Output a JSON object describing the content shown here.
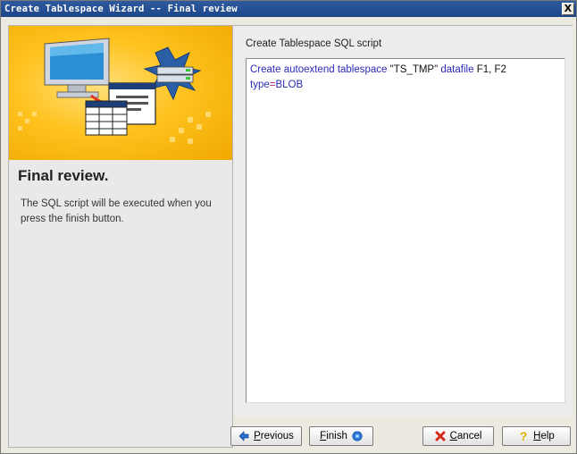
{
  "window": {
    "title": "Create Tablespace Wizard -- Final review",
    "close_label": "X"
  },
  "left": {
    "title": "Final review.",
    "description": "The SQL script will be executed when you press the finish button."
  },
  "right": {
    "script_label": "Create Tablespace SQL script",
    "script": {
      "line1": {
        "kw1": "Create autoextend tablespace",
        "str1": "\"TS_TMP\"",
        "kw2": "datafile",
        "str2": "F1, F2"
      },
      "line2": {
        "kw": "type",
        "op": "=",
        "val": "BLOB"
      }
    }
  },
  "buttons": {
    "previous": {
      "first": "P",
      "rest": "revious"
    },
    "finish": {
      "first": "F",
      "rest": "inish"
    },
    "cancel": {
      "first": "C",
      "rest": "ancel"
    },
    "help": {
      "first": "H",
      "rest": "elp"
    }
  },
  "icons": {
    "previous": "left-arrow-icon",
    "finish": "finish-icon",
    "cancel": "cancel-x-icon",
    "help": "help-question-icon"
  },
  "colors": {
    "titlebar": "#1c4688",
    "banner": "#ffc21e",
    "keyword": "#2a2ab8",
    "operator": "#b0207a"
  }
}
